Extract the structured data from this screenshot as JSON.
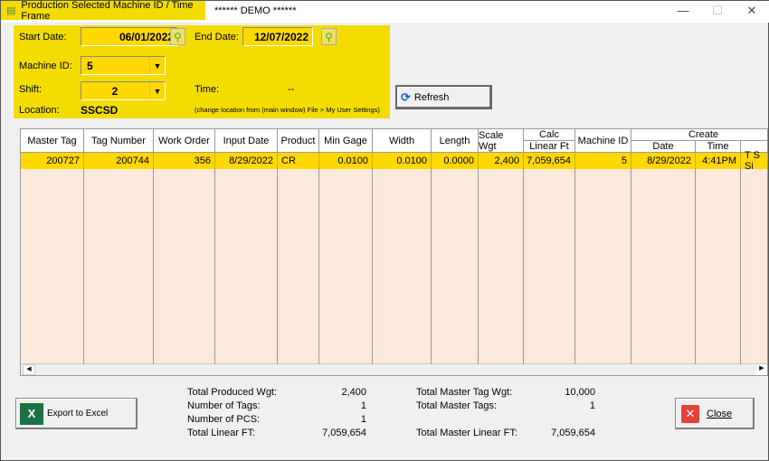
{
  "window": {
    "title": "Production  Selected Machine ID / Time Frame",
    "demo_label": "****** DEMO ******",
    "minimize": "—",
    "maximize": "☐",
    "close": "✕"
  },
  "filters": {
    "start_date_label": "Start Date:",
    "start_date": "06/01/2022",
    "end_date_label": "End Date:",
    "end_date": "12/07/2022",
    "machine_id_label": "Machine ID:",
    "machine_id": "5",
    "shift_label": "Shift:",
    "shift": "2",
    "time_label": "Time:",
    "time_value": "--",
    "location_label": "Location:",
    "location": "SSCSD",
    "location_hint": "(change location from (main window) File > My User Settings)"
  },
  "refresh_label": "Refresh",
  "grid": {
    "columns": [
      "Master Tag",
      "Tag Number",
      "Work Order",
      "Input Date",
      "Product",
      "Min Gage",
      "Width",
      "Length",
      "Scale Wgt",
      "Calc",
      "Machine ID",
      "Create"
    ],
    "calc_sub": "Linear Ft",
    "create_sub": [
      "Date",
      "Time"
    ],
    "rows": [
      [
        "200727",
        "200744",
        "356",
        "8/29/2022",
        "CR",
        "0.0100",
        "0.0100",
        "0.0000",
        "2,400",
        "7,059,654",
        "5",
        "8/29/2022",
        "4:41PM",
        "T S Si"
      ]
    ]
  },
  "totals": {
    "produced_wgt_label": "Total Produced Wgt:",
    "produced_wgt": "2,400",
    "num_tags_label": "Number of Tags:",
    "num_tags": "1",
    "num_pcs_label": "Number of PCS:",
    "num_pcs": "1",
    "linear_ft_label": "Total Linear FT:",
    "linear_ft": "7,059,654",
    "master_wgt_label": "Total Master Tag Wgt:",
    "master_wgt": "10,000",
    "master_tags_label": "Total Master Tags:",
    "master_tags": "1",
    "master_linear_label": "Total Master Linear FT:",
    "master_linear": "7,059,654"
  },
  "export_label": "Export to Excel",
  "close_label": "Close",
  "colors": {
    "highlight": "#f3dc00",
    "field": "#ffd800",
    "grid_bg": "#fde9dc"
  }
}
